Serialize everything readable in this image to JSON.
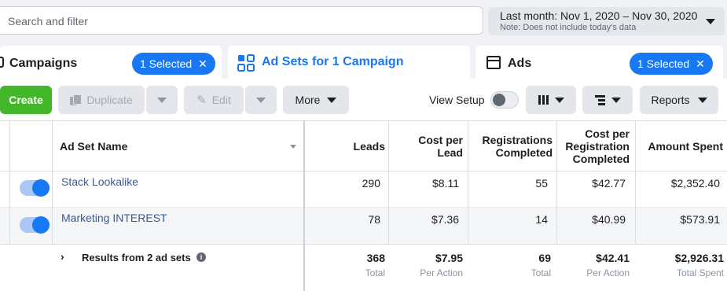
{
  "top": {
    "search_placeholder": "Search and filter",
    "date_range": "Last month: Nov 1, 2020 – Nov 30, 2020",
    "date_note": "Note: Does not include today's data"
  },
  "tabs": {
    "campaigns": {
      "label": "Campaigns",
      "selected": "1 Selected"
    },
    "adsets": {
      "label": "Ad Sets for 1 Campaign"
    },
    "ads": {
      "label": "Ads",
      "selected": "1 Selected"
    }
  },
  "toolbar": {
    "create": "Create",
    "duplicate": "Duplicate",
    "edit": "Edit",
    "more": "More",
    "view_setup": "View Setup",
    "reports": "Reports"
  },
  "table": {
    "col_name": "Ad Set Name",
    "col_leads": "Leads",
    "col_cpl": [
      "Cost per",
      "Lead"
    ],
    "col_reg": [
      "Registrations",
      "Completed"
    ],
    "col_cpr": [
      "Cost per",
      "Registration",
      "Completed"
    ],
    "col_spent": "Amount Spent",
    "rows": [
      {
        "name": "Stack Lookalike",
        "leads": "290",
        "cpl": "$8.11",
        "reg": "55",
        "cpr": "$42.77",
        "spent": "$2,352.40"
      },
      {
        "name": "Marketing INTEREST",
        "leads": "78",
        "cpl": "$7.36",
        "reg": "14",
        "cpr": "$40.99",
        "spent": "$573.91"
      }
    ],
    "totals": {
      "label": "Results from 2 ad sets",
      "leads": "368",
      "leads_sub": "Total",
      "cpl": "$7.95",
      "cpl_sub": "Per Action",
      "reg": "69",
      "reg_sub": "Total",
      "cpr": "$42.41",
      "cpr_sub": "Per Action",
      "spent": "$2,926.31",
      "spent_sub": "Total Spent"
    }
  },
  "colors": {
    "accent": "#1877f2",
    "create": "#42b72a",
    "link": "#385898"
  }
}
